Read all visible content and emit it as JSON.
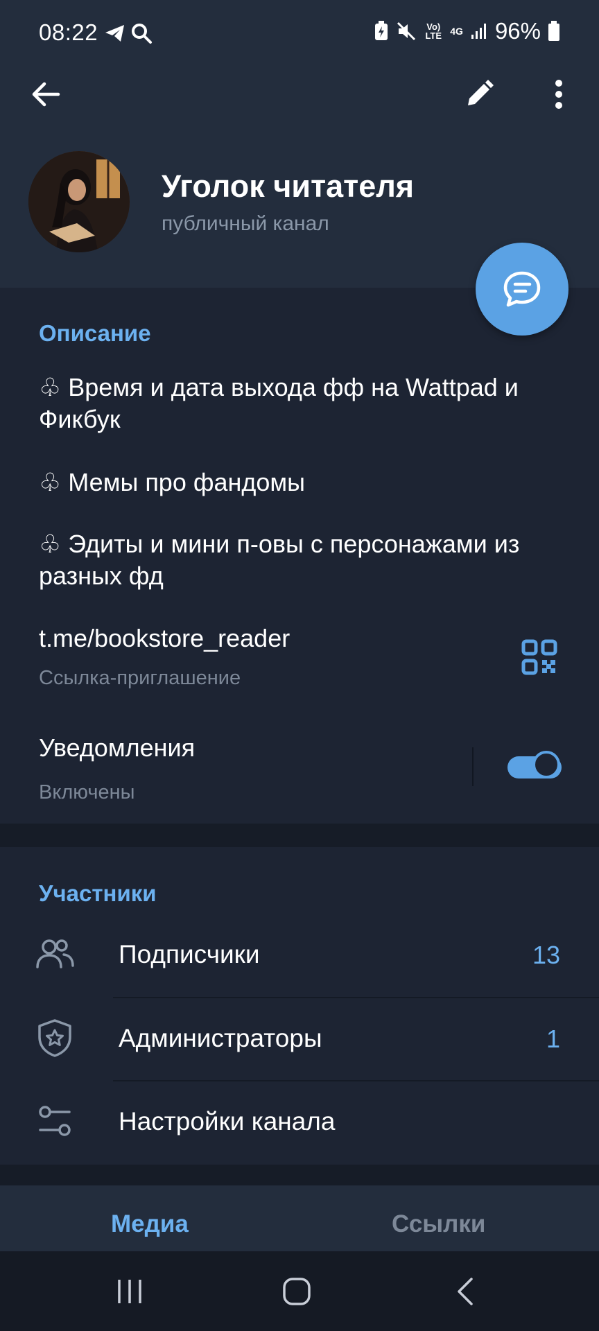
{
  "status_bar": {
    "time": "08:22",
    "battery": "96%",
    "network": "4G",
    "lte_label": "Vo) LTE"
  },
  "toolbar": {
    "back_icon": "arrow-left-icon",
    "edit_icon": "pencil-icon",
    "more_icon": "more-vertical-icon"
  },
  "channel": {
    "title": "Уголок читателя",
    "subtitle": "публичный канал"
  },
  "description": {
    "header": "Описание",
    "lines": [
      "♧ Время и дата выхода фф на Wattpad и Фикбук",
      "♧ Мемы про фандомы",
      "♧ Эдиты и мини п-овы с персонажами из разных фд"
    ]
  },
  "invite": {
    "link": "t.me/bookstore_reader",
    "label": "Ссылка-приглашение"
  },
  "notifications": {
    "title": "Уведомления",
    "status": "Включены",
    "enabled": true
  },
  "members": {
    "header": "Участники",
    "rows": [
      {
        "label": "Подписчики",
        "count": "13",
        "icon": "people-icon"
      },
      {
        "label": "Администраторы",
        "count": "1",
        "icon": "shield-star-icon"
      },
      {
        "label": "Настройки канала",
        "count": "",
        "icon": "sliders-icon"
      }
    ]
  },
  "tabs": [
    {
      "label": "Медиа",
      "active": true
    },
    {
      "label": "Ссылки",
      "active": false
    }
  ],
  "colors": {
    "accent": "#5ba2e4",
    "background": "#1d2433",
    "header_bg": "#232d3d"
  }
}
